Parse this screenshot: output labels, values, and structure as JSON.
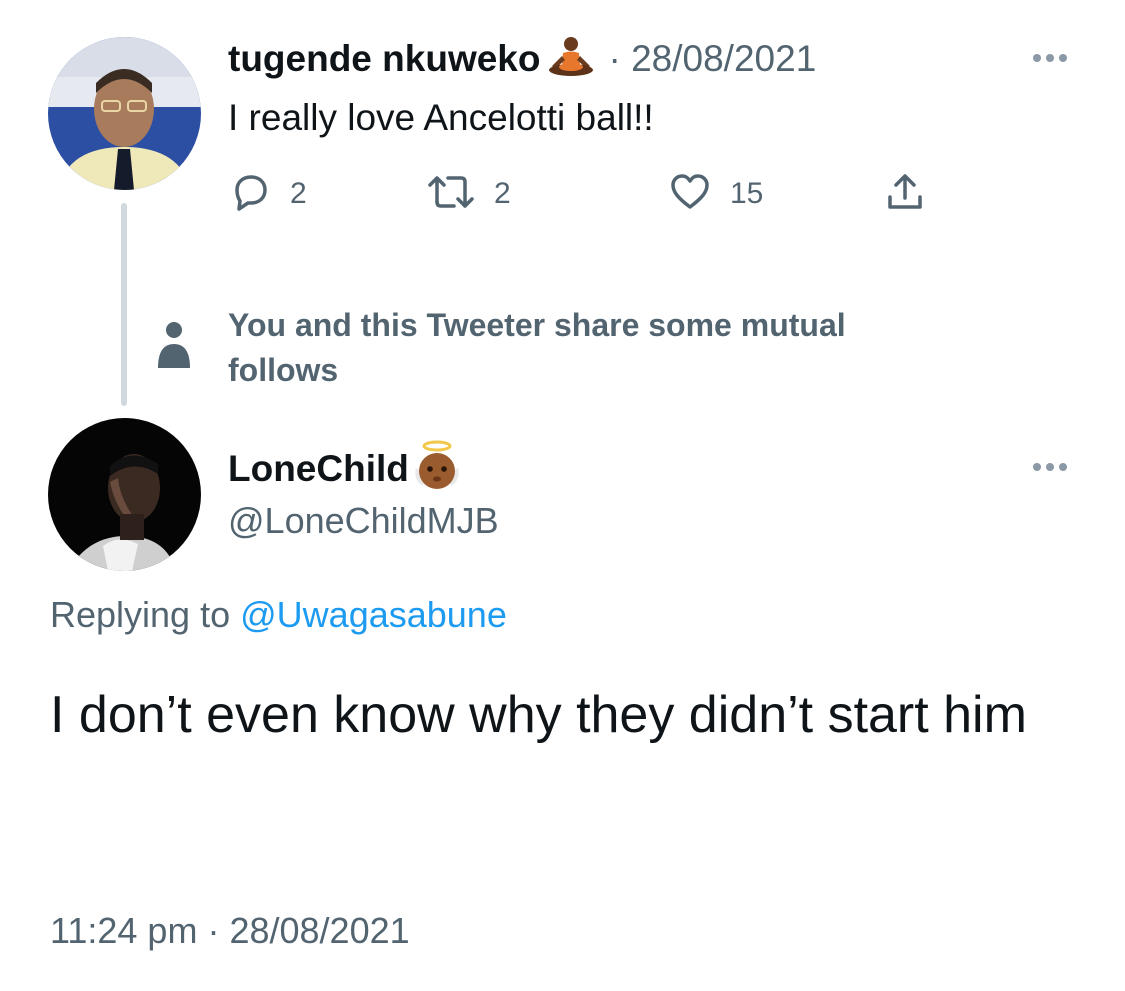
{
  "parent_tweet": {
    "display_name": "tugende nkuweko",
    "name_emoji": "person-in-lotus-position-emoji",
    "separator": "·",
    "date": "28/08/2021",
    "text": "I really love Ancelotti ball!!",
    "reply_count": "2",
    "retweet_count": "2",
    "like_count": "15"
  },
  "mutual_follows": {
    "text": "You and this Tweeter share some mutual follows"
  },
  "main_tweet": {
    "display_name": "LoneChild",
    "name_emoji": "baby-angel-emoji",
    "handle": "@LoneChildMJB",
    "replying_label": "Replying to",
    "replying_mention": "@Uwagasabune",
    "text": "I don’t even know why they didn’t start him",
    "time": "11:24 pm",
    "separator": "·",
    "date": "28/08/2021"
  },
  "colors": {
    "text_primary": "#0f1419",
    "text_secondary": "#536471",
    "link": "#1d9bf0",
    "thread_line": "#cfd9de"
  },
  "icons": [
    "reply-icon",
    "retweet-icon",
    "like-icon",
    "share-icon",
    "more-icon",
    "person-icon"
  ]
}
